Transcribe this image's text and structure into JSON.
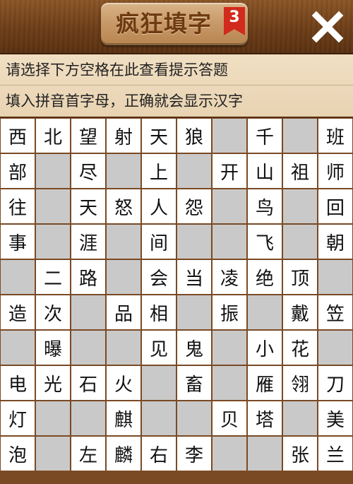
{
  "header": {
    "title": "疯狂填字",
    "level": "3"
  },
  "hints": {
    "line1": "请选择下方空格在此查看提示答题",
    "line2": "填入拼音首字母，正确就会显示汉字"
  },
  "grid": {
    "rows": [
      [
        "西",
        "北",
        "望",
        "射",
        "天",
        "狼",
        "",
        "千",
        "",
        "班"
      ],
      [
        "部",
        "",
        "尽",
        "",
        "上",
        "",
        "开",
        "山",
        "祖",
        "师"
      ],
      [
        "往",
        "",
        "天",
        "怒",
        "人",
        "怨",
        "",
        "鸟",
        "",
        "回"
      ],
      [
        "事",
        "",
        "涯",
        "",
        "间",
        "",
        "",
        "飞",
        "",
        "朝"
      ],
      [
        "",
        "二",
        "路",
        "",
        "会",
        "当",
        "凌",
        "绝",
        "顶",
        ""
      ],
      [
        "造",
        "次",
        "",
        "品",
        "相",
        "",
        "振",
        "",
        "戴",
        "笠"
      ],
      [
        "",
        "曝",
        "",
        "",
        "见",
        "鬼",
        "",
        "小",
        "花",
        ""
      ],
      [
        "电",
        "光",
        "石",
        "火",
        "",
        "畜",
        "",
        "雁",
        "翎",
        "刀"
      ],
      [
        "灯",
        "",
        "",
        "麒",
        "",
        "",
        "贝",
        "塔",
        "",
        "美"
      ],
      [
        "泡",
        "",
        "左",
        "麟",
        "右",
        "李",
        "",
        "",
        "张",
        "兰"
      ]
    ]
  }
}
